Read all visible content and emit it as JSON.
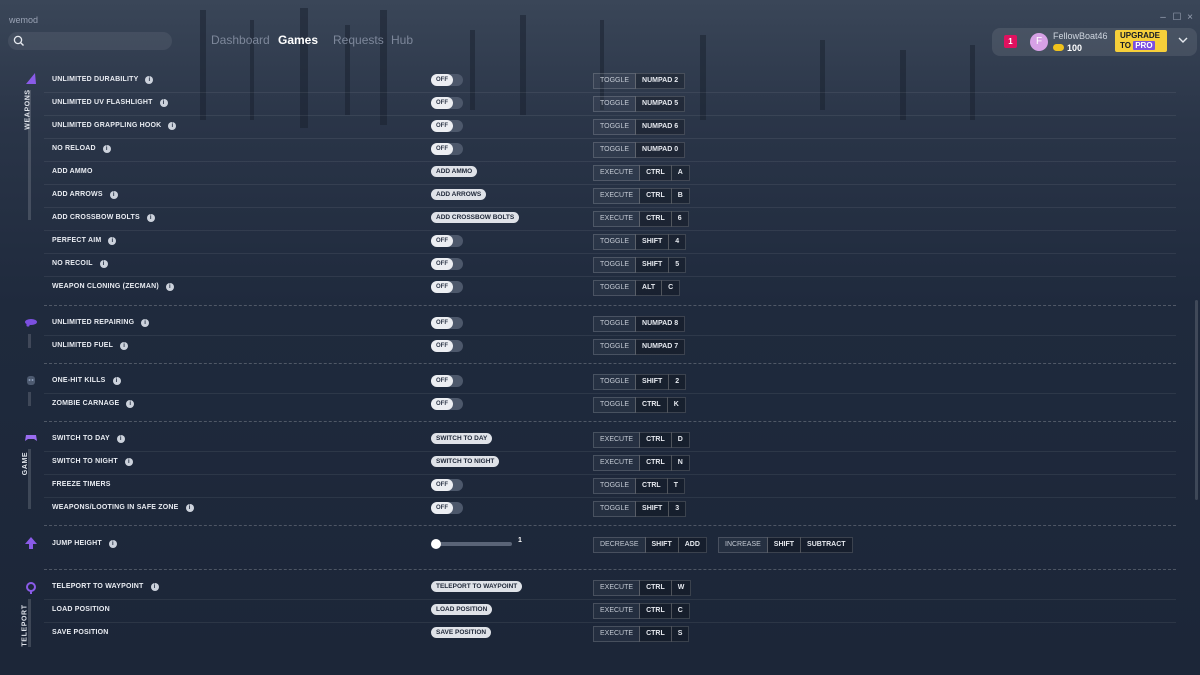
{
  "app": {
    "title": "wemod"
  },
  "nav": {
    "items": [
      "Dashboard",
      "Games",
      "Requests",
      "Hub"
    ],
    "active": "Games"
  },
  "user": {
    "notifications": "1",
    "avatar_letter": "F",
    "name": "FellowBoat46",
    "coins": "100",
    "upgrade_line1": "UPGRADE",
    "upgrade_to": "TO",
    "upgrade_pro": "PRO"
  },
  "window": {
    "minimize": "–",
    "maximize": "☐",
    "close": "×"
  },
  "categories": [
    {
      "label": "WEAPONS",
      "icon": "weapon-icon"
    },
    {
      "label": "",
      "icon": "vehicle-icon"
    },
    {
      "label": "",
      "icon": "enemy-icon"
    },
    {
      "label": "GAME",
      "icon": "gamepad-icon"
    },
    {
      "label": "",
      "icon": "jump-arrow-icon"
    },
    {
      "label": "TELEPORT",
      "icon": "teleport-icon"
    }
  ],
  "cheats": [
    {
      "name": "UNLIMITED DURABILITY",
      "info": true,
      "control": "toggle",
      "state": "OFF",
      "keys": [
        "TOGGLE",
        "NUMPAD 2"
      ]
    },
    {
      "name": "UNLIMITED UV FLASHLIGHT",
      "info": true,
      "control": "toggle",
      "state": "OFF",
      "keys": [
        "TOGGLE",
        "NUMPAD 5"
      ]
    },
    {
      "name": "UNLIMITED GRAPPLING HOOK",
      "info": true,
      "control": "toggle",
      "state": "OFF",
      "keys": [
        "TOGGLE",
        "NUMPAD 6"
      ]
    },
    {
      "name": "NO RELOAD",
      "info": true,
      "control": "toggle",
      "state": "OFF",
      "keys": [
        "TOGGLE",
        "NUMPAD 0"
      ]
    },
    {
      "name": "ADD AMMO",
      "info": false,
      "control": "button",
      "button": "ADD AMMO",
      "keys": [
        "EXECUTE",
        "CTRL",
        "A"
      ]
    },
    {
      "name": "ADD ARROWS",
      "info": true,
      "control": "button",
      "button": "ADD ARROWS",
      "keys": [
        "EXECUTE",
        "CTRL",
        "B"
      ]
    },
    {
      "name": "ADD CROSSBOW BOLTS",
      "info": true,
      "control": "button",
      "button": "ADD CROSSBOW BOLTS",
      "keys": [
        "EXECUTE",
        "CTRL",
        "6"
      ]
    },
    {
      "name": "PERFECT AIM",
      "info": true,
      "control": "toggle",
      "state": "OFF",
      "keys": [
        "TOGGLE",
        "SHIFT",
        "4"
      ]
    },
    {
      "name": "NO RECOIL",
      "info": true,
      "control": "toggle",
      "state": "OFF",
      "keys": [
        "TOGGLE",
        "SHIFT",
        "5"
      ]
    },
    {
      "name": "WEAPON CLONING (ZECMAN)",
      "info": true,
      "control": "toggle",
      "state": "OFF",
      "keys": [
        "TOGGLE",
        "ALT",
        "C"
      ]
    },
    {
      "name": "UNLIMITED REPAIRING",
      "info": true,
      "control": "toggle",
      "state": "OFF",
      "keys": [
        "TOGGLE",
        "NUMPAD 8"
      ]
    },
    {
      "name": "UNLIMITED FUEL",
      "info": true,
      "control": "toggle",
      "state": "OFF",
      "keys": [
        "TOGGLE",
        "NUMPAD 7"
      ]
    },
    {
      "name": "ONE-HIT KILLS",
      "info": true,
      "control": "toggle",
      "state": "OFF",
      "keys": [
        "TOGGLE",
        "SHIFT",
        "2"
      ]
    },
    {
      "name": "ZOMBIE CARNAGE",
      "info": true,
      "control": "toggle",
      "state": "OFF",
      "keys": [
        "TOGGLE",
        "CTRL",
        "K"
      ]
    },
    {
      "name": "SWITCH TO DAY",
      "info": true,
      "control": "button",
      "button": "SWITCH TO DAY",
      "keys": [
        "EXECUTE",
        "CTRL",
        "D"
      ]
    },
    {
      "name": "SWITCH TO NIGHT",
      "info": true,
      "control": "button",
      "button": "SWITCH TO NIGHT",
      "keys": [
        "EXECUTE",
        "CTRL",
        "N"
      ]
    },
    {
      "name": "FREEZE TIMERS",
      "info": false,
      "control": "toggle",
      "state": "OFF",
      "keys": [
        "TOGGLE",
        "CTRL",
        "T"
      ]
    },
    {
      "name": "WEAPONS/LOOTING IN SAFE ZONE",
      "info": true,
      "control": "toggle",
      "state": "OFF",
      "keys": [
        "TOGGLE",
        "SHIFT",
        "3"
      ]
    },
    {
      "name": "JUMP HEIGHT",
      "info": true,
      "control": "slider",
      "value": "1",
      "keys": [
        "DECREASE",
        "SHIFT",
        "ADD"
      ],
      "keys2": [
        "INCREASE",
        "SHIFT",
        "SUBTRACT"
      ]
    },
    {
      "name": "TELEPORT TO WAYPOINT",
      "info": true,
      "control": "button",
      "button": "TELEPORT TO WAYPOINT",
      "keys": [
        "EXECUTE",
        "CTRL",
        "W"
      ]
    },
    {
      "name": "LOAD POSITION",
      "info": false,
      "control": "button",
      "button": "LOAD POSITION",
      "keys": [
        "EXECUTE",
        "CTRL",
        "C"
      ]
    },
    {
      "name": "SAVE POSITION",
      "info": false,
      "control": "button",
      "button": "SAVE POSITION",
      "keys": [
        "EXECUTE",
        "CTRL",
        "S"
      ]
    }
  ],
  "colors": {
    "background": "#1e2a3e",
    "accent": "#7b4fe0",
    "notification": "#e0115f",
    "upgrade": "#f6cf3a"
  }
}
